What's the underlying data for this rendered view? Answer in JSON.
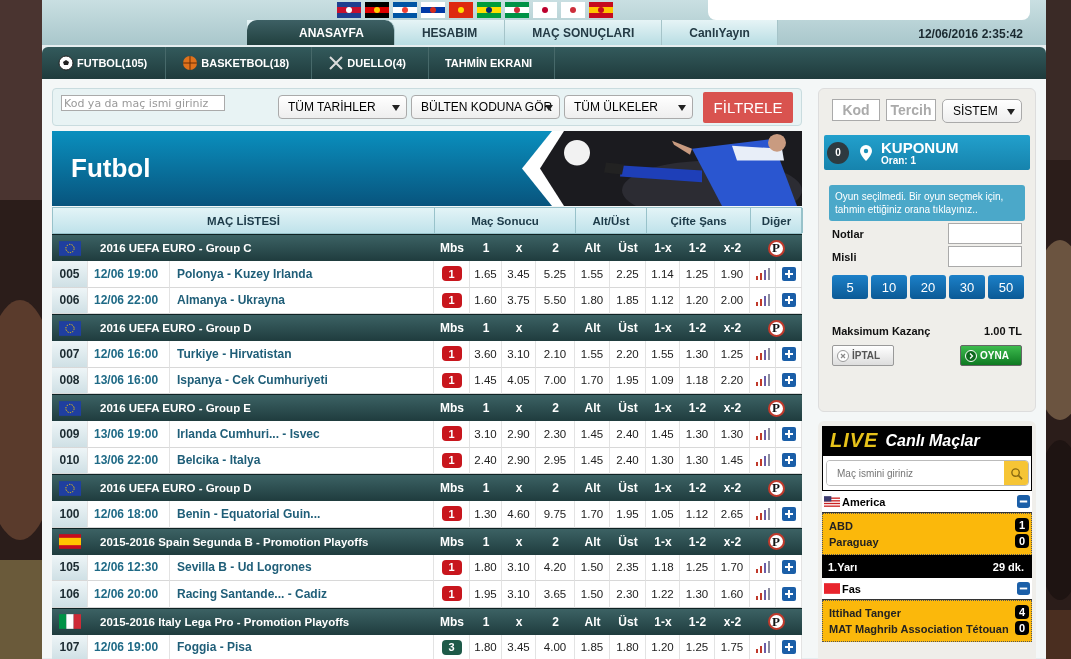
{
  "nav": {
    "tabs": [
      {
        "label": "ANASAYFA",
        "selected": true
      },
      {
        "label": "HESABIM",
        "selected": false
      },
      {
        "label": "MAÇ SONUÇLARI",
        "selected": false
      },
      {
        "label": "CanlıYayın",
        "selected": false
      }
    ],
    "datetime": "12/06/2016 2:35:42"
  },
  "sports": [
    {
      "label": "FUTBOL(105)",
      "kind": "football"
    },
    {
      "label": "BASKETBOL(18)",
      "kind": "basketball"
    },
    {
      "label": "DUELLO(4)",
      "kind": "duel"
    },
    {
      "label": "TAHMİN EKRANI",
      "kind": "none"
    }
  ],
  "filter": {
    "placeholder": "Kod ya da maç ismi giriniz",
    "selects": [
      "TÜM TARİHLER",
      "BÜLTEN KODUNA GÖR",
      "TÜM ÜLKELER"
    ],
    "button": "FİLTRELE"
  },
  "banner": {
    "title": "Futbol"
  },
  "table": {
    "columns": [
      "MAÇ LİSTESİ",
      "Maç Sonucu",
      "Alt/Üst",
      "Çifte Şans",
      "Diğer"
    ],
    "groups": [
      {
        "name": "2016 UEFA EURO - Group C",
        "kind": "eu",
        "columns": [
          "Mbs",
          "1",
          "x",
          "2",
          "Alt",
          "Üst",
          "1-x",
          "1-2",
          "x-2"
        ],
        "p": "P",
        "matches": [
          {
            "code": "005",
            "time": "12/06 19:00",
            "teams": "Polonya - Kuzey Irlanda",
            "mbs": "1",
            "color": "#c8161d",
            "odds": [
              "1.65",
              "3.45",
              "5.25",
              "1.55",
              "2.25",
              "1.14",
              "1.25",
              "1.90"
            ]
          },
          {
            "code": "006",
            "time": "12/06 22:00",
            "teams": "Almanya - Ukrayna",
            "mbs": "1",
            "color": "#c8161d",
            "odds": [
              "1.60",
              "3.75",
              "5.50",
              "1.80",
              "1.85",
              "1.12",
              "1.20",
              "2.00"
            ]
          }
        ]
      },
      {
        "name": "2016 UEFA EURO - Group D",
        "kind": "eu",
        "columns": [
          "Mbs",
          "1",
          "x",
          "2",
          "Alt",
          "Üst",
          "1-x",
          "1-2",
          "x-2"
        ],
        "p": "P",
        "matches": [
          {
            "code": "007",
            "time": "12/06 16:00",
            "teams": "Turkiye - Hirvatistan",
            "mbs": "1",
            "color": "#c8161d",
            "odds": [
              "3.60",
              "3.10",
              "2.10",
              "1.55",
              "2.20",
              "1.55",
              "1.30",
              "1.25"
            ]
          },
          {
            "code": "008",
            "time": "13/06 16:00",
            "teams": "Ispanya - Cek Cumhuriyeti",
            "mbs": "1",
            "color": "#c8161d",
            "odds": [
              "1.45",
              "4.05",
              "7.00",
              "1.70",
              "1.95",
              "1.09",
              "1.18",
              "2.20"
            ]
          }
        ]
      },
      {
        "name": "2016 UEFA EURO - Group E",
        "kind": "eu",
        "columns": [
          "Mbs",
          "1",
          "x",
          "2",
          "Alt",
          "Üst",
          "1-x",
          "1-2",
          "x-2"
        ],
        "p": "P",
        "matches": [
          {
            "code": "009",
            "time": "13/06 19:00",
            "teams": "Irlanda Cumhuri... - Isvec",
            "mbs": "1",
            "color": "#c8161d",
            "odds": [
              "3.10",
              "2.90",
              "2.30",
              "1.45",
              "2.40",
              "1.45",
              "1.30",
              "1.30"
            ]
          },
          {
            "code": "010",
            "time": "13/06 22:00",
            "teams": "Belcika - Italya",
            "mbs": "1",
            "color": "#c8161d",
            "odds": [
              "2.40",
              "2.90",
              "2.95",
              "1.45",
              "2.40",
              "1.30",
              "1.30",
              "1.45"
            ]
          }
        ]
      },
      {
        "name": "2016 UEFA EURO - Group D",
        "kind": "eu",
        "columns": [
          "Mbs",
          "1",
          "x",
          "2",
          "Alt",
          "Üst",
          "1-x",
          "1-2",
          "x-2"
        ],
        "p": "P",
        "matches": [
          {
            "code": "100",
            "time": "12/06 18:00",
            "teams": "Benin - Equatorial Guin...",
            "mbs": "1",
            "color": "#c8161d",
            "odds": [
              "1.30",
              "4.60",
              "9.75",
              "1.70",
              "1.95",
              "1.05",
              "1.12",
              "2.65"
            ]
          }
        ]
      },
      {
        "name": "2015-2016 Spain Segunda B - Promotion Playoffs",
        "kind": "es",
        "columns": [
          "Mbs",
          "1",
          "x",
          "2",
          "Alt",
          "Üst",
          "1-x",
          "1-2",
          "x-2"
        ],
        "p": "P",
        "matches": [
          {
            "code": "105",
            "time": "12/06 12:30",
            "teams": "Sevilla B - Ud Logrones",
            "mbs": "1",
            "color": "#c8161d",
            "odds": [
              "1.80",
              "3.10",
              "4.20",
              "1.50",
              "2.35",
              "1.18",
              "1.25",
              "1.70"
            ]
          },
          {
            "code": "106",
            "time": "12/06 20:00",
            "teams": "Racing Santande... - Cadiz",
            "mbs": "1",
            "color": "#c8161d",
            "odds": [
              "1.95",
              "3.10",
              "3.65",
              "1.50",
              "2.30",
              "1.22",
              "1.30",
              "1.60"
            ]
          }
        ]
      },
      {
        "name": "2015-2016 Italy Lega Pro - Promotion Playoffs",
        "kind": "it",
        "columns": [
          "Mbs",
          "1",
          "x",
          "2",
          "Alt",
          "Üst",
          "1-x",
          "1-2",
          "x-2"
        ],
        "p": "P",
        "matches": [
          {
            "code": "107",
            "time": "12/06 19:00",
            "teams": "Foggia - Pisa",
            "mbs": "3",
            "color": "#1e5a48",
            "odds": [
              "1.80",
              "3.45",
              "4.00",
              "1.85",
              "1.80",
              "1.20",
              "1.25",
              "1.75"
            ]
          }
        ]
      }
    ]
  },
  "coupon": {
    "code_placeholder": "Kod",
    "choice_placeholder": "Tercih",
    "system": "SİSTEM",
    "count": "0",
    "title": "KUPONUM",
    "rate": "Oran: 1",
    "info": "Oyun seçilmedi. Bir oyun seçmek için, tahmin ettiğiniz orana tıklayınız..",
    "fields": [
      "Notlar",
      "Misli"
    ],
    "amounts": [
      "5",
      "10",
      "20",
      "30",
      "50"
    ],
    "max_label": "Maksimum Kazanç",
    "max_value": "1.00 TL",
    "cancel": "İPTAL",
    "play": "OYNA"
  },
  "live": {
    "logo": "LIVE",
    "title": "Canlı Maçlar",
    "placeholder": "Maç ismini giriniz",
    "leagues": [
      {
        "name": "America",
        "kind": "us",
        "expanded": true,
        "teams": [
          {
            "name": "ABD",
            "score": "1"
          },
          {
            "name": "Paraguay",
            "score": "0"
          }
        ],
        "period": "1.Yarı",
        "minute": "29 dk."
      },
      {
        "name": "Fas",
        "kind": "ma",
        "expanded": true,
        "teams": [
          {
            "name": "Ittihad Tanger",
            "score": "4"
          },
          {
            "name": "MAT Maghrib Association Tétouan",
            "score": "0"
          }
        ]
      }
    ]
  }
}
